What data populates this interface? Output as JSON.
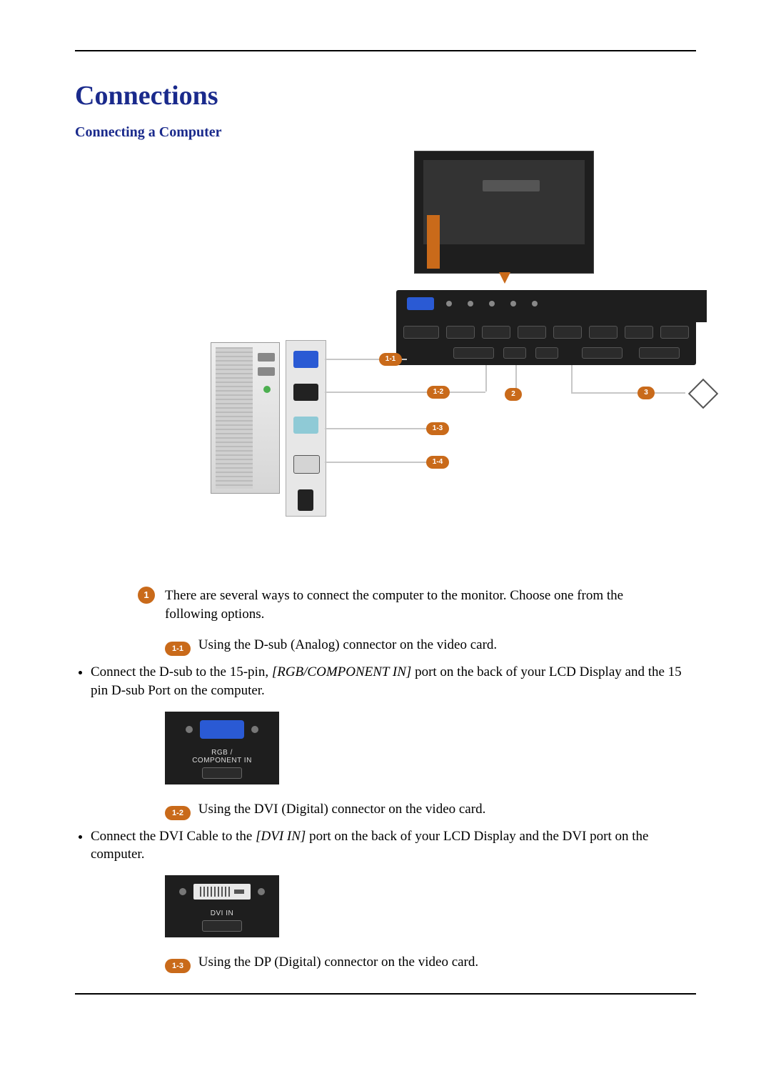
{
  "heading": "Connections",
  "subheading": "Connecting a Computer",
  "diagram": {
    "wire_badges": {
      "b11": "1-1",
      "b12": "1-2",
      "b2": "2",
      "b13": "1-3",
      "b14": "1-4",
      "b3": "3"
    }
  },
  "lead_badge": "1",
  "intro": "There are several ways to connect the computer to the monitor. Choose one from the following options.",
  "sections": [
    {
      "pill": "1-1",
      "line": "Using the D-sub (Analog) connector on the video card.",
      "bullet_pre": "Connect the D-sub to the 15-pin, ",
      "bullet_emph": "[RGB/COMPONENT IN]",
      "bullet_post": " port on the back of your LCD Display and the 15 pin D-sub Port on the computer.",
      "thumb_label": "RGB /\nCOMPONENT IN",
      "thumb_kind": "rgb"
    },
    {
      "pill": "1-2",
      "line": "Using the DVI (Digital) connector on the video card.",
      "bullet_pre": "Connect the DVI Cable to the ",
      "bullet_emph": "[DVI IN]",
      "bullet_post": " port on the back of your LCD Display and the DVI port on the computer.",
      "thumb_label": "DVI IN",
      "thumb_kind": "dvi"
    },
    {
      "pill": "1-3",
      "line": "Using the DP (Digital) connector on the video card."
    }
  ]
}
